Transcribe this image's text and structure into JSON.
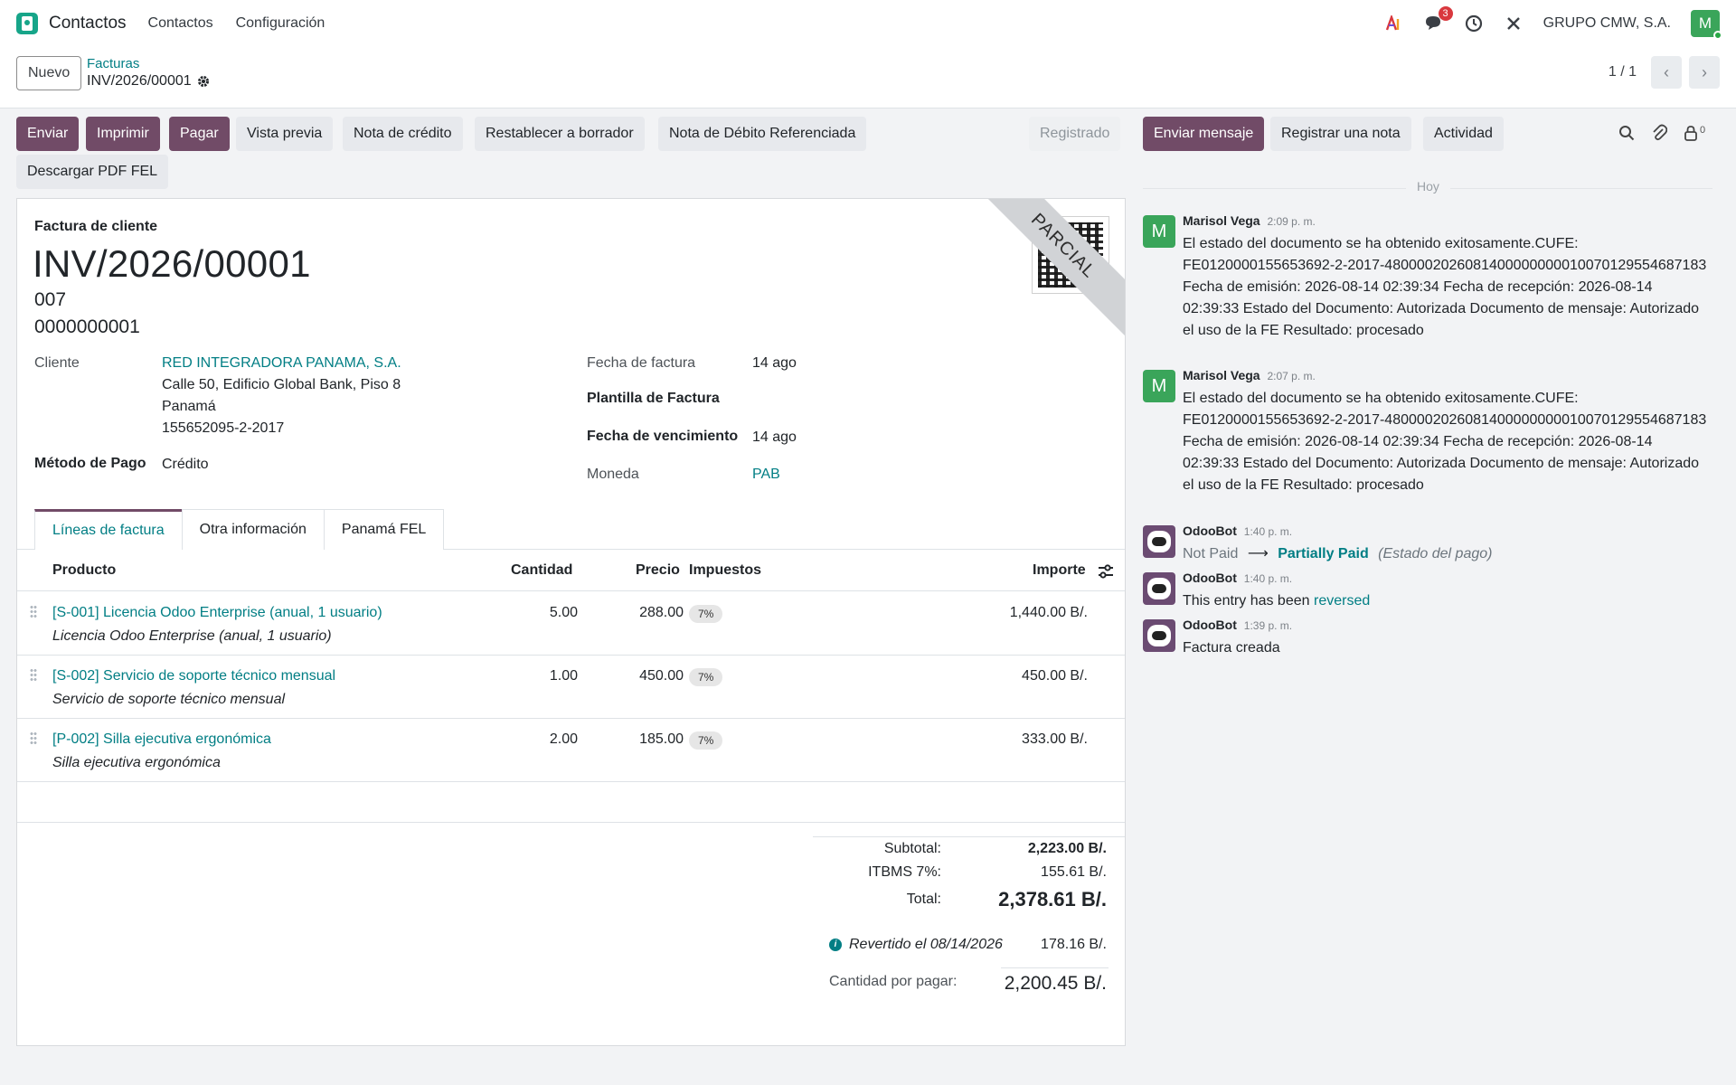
{
  "navbar": {
    "app_name": "Contactos",
    "menu": [
      "Contactos",
      "Configuración"
    ],
    "notifications": "3",
    "company": "GRUPO CMW, S.A.",
    "avatar_letter": "M"
  },
  "control": {
    "new_label": "Nuevo",
    "breadcrumb_parent": "Facturas",
    "breadcrumb_current": "INV/2026/00001",
    "pager": "1 / 1"
  },
  "actions": {
    "enviar": "Enviar",
    "imprimir": "Imprimir",
    "pagar": "Pagar",
    "vista_previa": "Vista previa",
    "nota_credito": "Nota de crédito",
    "restablecer": "Restablecer a borrador",
    "nota_debito": "Nota de Débito Referenciada",
    "descargar": "Descargar PDF FEL",
    "status": "Registrado"
  },
  "invoice": {
    "ribbon": "PARCIAL",
    "doc_type": "Factura de cliente",
    "number": "INV/2026/00001",
    "sub1": "007",
    "sub2": "0000000001",
    "fields": {
      "cliente_label": "Cliente",
      "cliente_name": "RED INTEGRADORA PANAMA, S.A.",
      "cliente_addr1": "Calle 50, Edificio Global Bank, Piso 8",
      "cliente_addr2": "Panamá",
      "cliente_ruc": "155652095-2-2017",
      "metodo_label": "Método de Pago",
      "metodo_value": "Crédito",
      "fecha_factura_label": "Fecha de factura",
      "fecha_factura_value": "14 ago",
      "plantilla_label": "Plantilla de Factura",
      "vencimiento_label": "Fecha de vencimiento",
      "vencimiento_value": "14 ago",
      "moneda_label": "Moneda",
      "moneda_value": "PAB"
    },
    "tabs": [
      "Líneas de factura",
      "Otra información",
      "Panamá FEL"
    ],
    "columns": {
      "producto": "Producto",
      "cantidad": "Cantidad",
      "precio": "Precio",
      "impuestos": "Impuestos",
      "importe": "Importe"
    },
    "lines": [
      {
        "product": "[S-001] Licencia Odoo Enterprise (anual, 1 usuario)",
        "desc": "Licencia Odoo Enterprise (anual, 1 usuario)",
        "qty": "5.00",
        "price": "288.00",
        "tax": "7%",
        "amount": "1,440.00 B/."
      },
      {
        "product": "[S-002] Servicio de soporte técnico mensual",
        "desc": "Servicio de soporte técnico mensual",
        "qty": "1.00",
        "price": "450.00",
        "tax": "7%",
        "amount": "450.00 B/."
      },
      {
        "product": "[P-002] Silla ejecutiva ergonómica",
        "desc": "Silla ejecutiva ergonómica",
        "qty": "2.00",
        "price": "185.00",
        "tax": "7%",
        "amount": "333.00 B/."
      }
    ],
    "totals": {
      "subtotal_label": "Subtotal:",
      "subtotal_value": "2,223.00 B/.",
      "itbms_label": "ITBMS 7%:",
      "itbms_value": "155.61 B/.",
      "total_label": "Total:",
      "total_value": "2,378.61 B/.",
      "reversed_label": "Revertido el 08/14/2026",
      "reversed_value": "178.16 B/.",
      "due_label": "Cantidad por pagar:",
      "due_value": "2,200.45 B/."
    }
  },
  "chatter": {
    "send_message": "Enviar mensaje",
    "log_note": "Registrar una nota",
    "activity": "Actividad",
    "followers": "0",
    "separator": "Hoy",
    "messages": [
      {
        "author": "Marisol Vega",
        "time": "2:09 p. m.",
        "avatar": "M",
        "body": "El estado del documento se ha obtenido exitosamente.CUFE: FE0120000155653692-2-2017-4800002026081400000000010070129554687183 Fecha de emisión: 2026-08-14 02:39:34 Fecha de recepción: 2026-08-14 02:39:33 Estado del Documento: Autorizada Documento de mensaje: Autorizado el uso de la FE Resultado: procesado"
      },
      {
        "author": "Marisol Vega",
        "time": "2:07 p. m.",
        "avatar": "M",
        "body": "El estado del documento se ha obtenido exitosamente.CUFE: FE0120000155653692-2-2017-4800002026081400000000010070129554687183 Fecha de emisión: 2026-08-14 02:39:34 Fecha de recepción: 2026-08-14 02:39:33 Estado del Documento: Autorizada Documento de mensaje: Autorizado el uso de la FE Resultado: procesado"
      },
      {
        "author": "OdooBot",
        "time": "1:40 p. m.",
        "from": "Not Paid",
        "to": "Partially Paid",
        "field": "(Estado del pago)"
      },
      {
        "author": "OdooBot",
        "time": "1:40 p. m.",
        "body_prefix": "This entry has been",
        "body_link": "reversed"
      },
      {
        "author": "OdooBot",
        "time": "1:39 p. m.",
        "body": "Factura creada"
      }
    ]
  },
  "colors": {
    "primary": "#714b67",
    "link": "#017e84",
    "avatar_green": "#3aa55a"
  }
}
